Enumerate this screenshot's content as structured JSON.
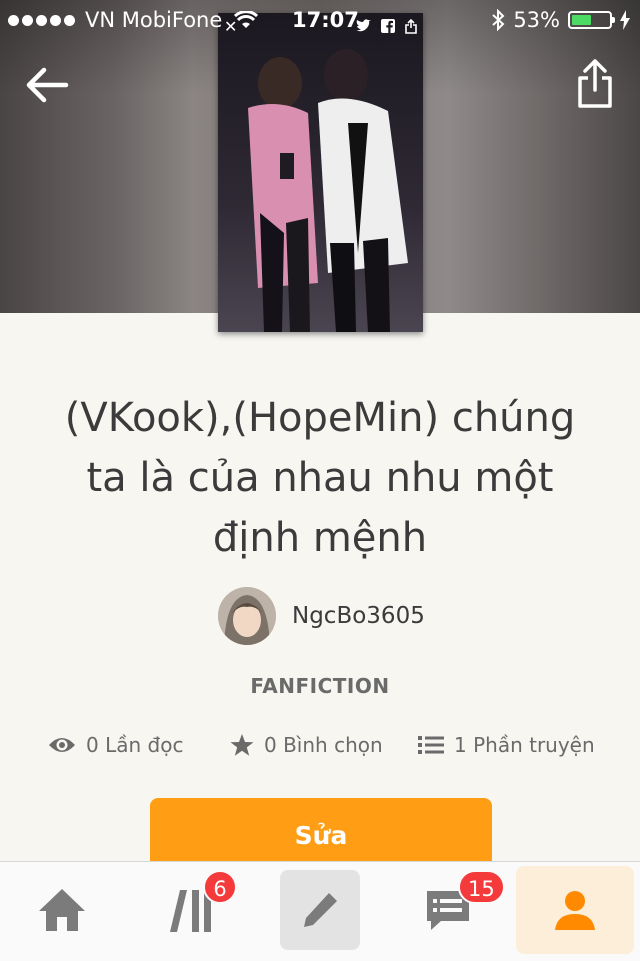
{
  "status_bar": {
    "carrier": "VN MobiFone",
    "time": "17:07",
    "battery": "53%",
    "battery_level": 0.53
  },
  "header": {
    "back_icon": "arrow-left-icon",
    "share_icon": "share-icon"
  },
  "cover": {
    "close_glyph": "✕"
  },
  "story": {
    "title": "(VKook),(HopeMin) chúng ta là của nhau nhu một định mệnh",
    "author": "NgcBo3605",
    "category": "FANFICTION",
    "stats": {
      "reads": "0 Lần đọc",
      "votes": "0 Bình chọn",
      "parts": "1 Phần truyện"
    },
    "edit_label": "Sửa"
  },
  "tabbar": {
    "tabs": [
      {
        "name": "home",
        "icon": "home-icon"
      },
      {
        "name": "library",
        "icon": "library-icon",
        "badge": "6"
      },
      {
        "name": "write",
        "icon": "pencil-icon"
      },
      {
        "name": "messages",
        "icon": "chat-icon",
        "badge": "15"
      },
      {
        "name": "profile",
        "icon": "person-icon"
      }
    ]
  },
  "colors": {
    "accent": "#ff9d14",
    "badge": "#f43a3a",
    "background": "#f7f6f1"
  }
}
